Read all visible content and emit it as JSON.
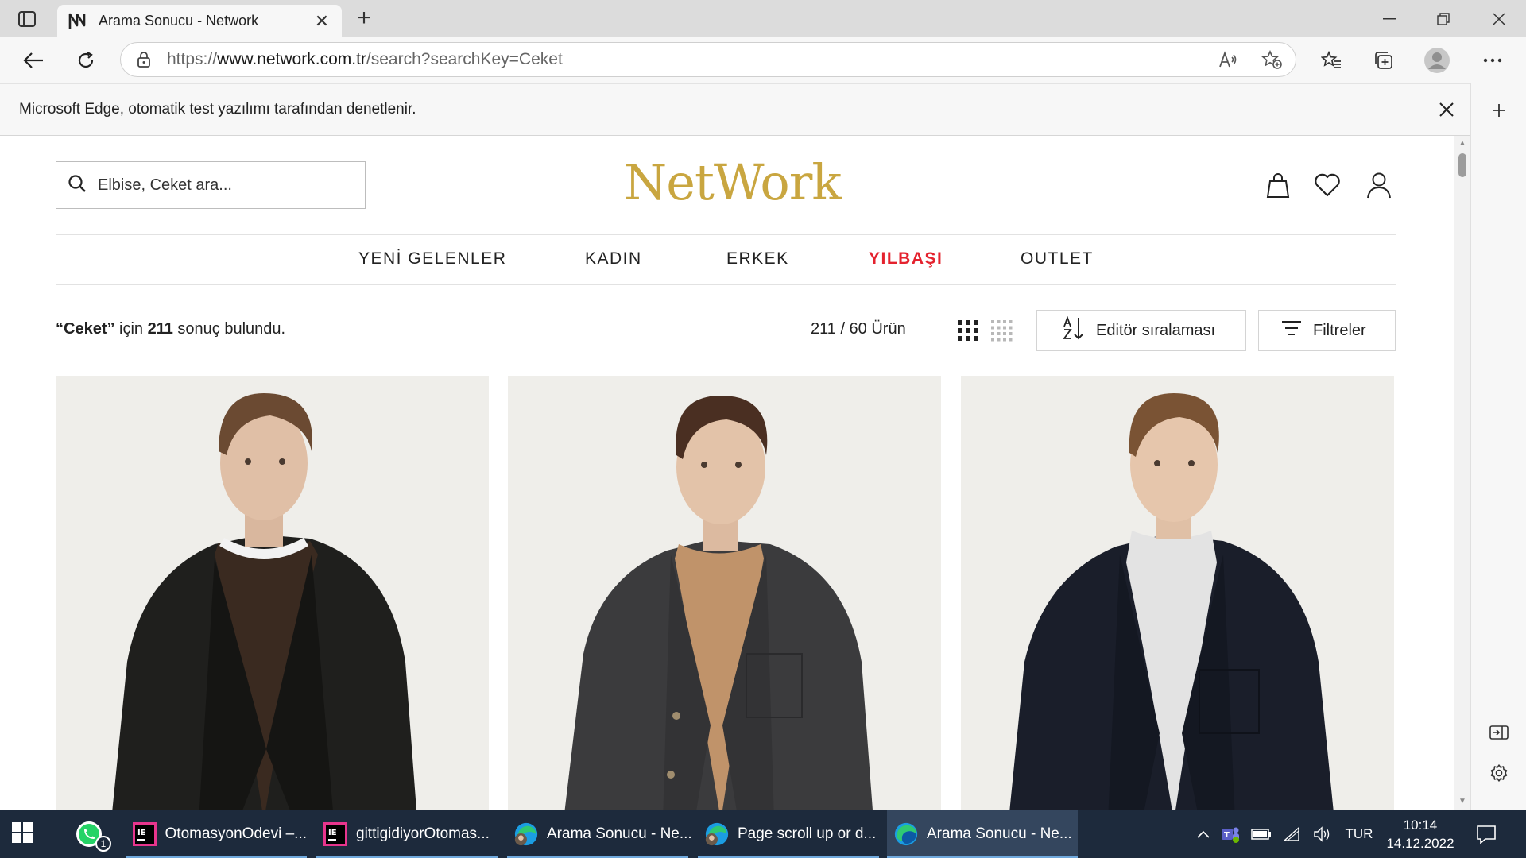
{
  "browser": {
    "tab_title": "Arama Sonucu - Network",
    "new_tab_label": "+",
    "url_scheme": "https://",
    "url_host": "www.network.com.tr",
    "url_path": "/search?searchKey=Ceket",
    "infobar_text": "Microsoft Edge, otomatik test yazılımı tarafından denetlenir."
  },
  "page": {
    "logo": "NetWork",
    "search_placeholder": "Elbise, Ceket ara...",
    "nav": [
      {
        "label": "YENİ GELENLER"
      },
      {
        "label": "KADIN"
      },
      {
        "label": "ERKEK"
      },
      {
        "label": "YILBAŞI",
        "highlight": true
      },
      {
        "label": "OUTLET"
      }
    ],
    "results": {
      "quote_open": "“",
      "query": "Ceket",
      "quote_close": "”",
      "for_word": " için ",
      "count": "211",
      "suffix": " sonuç bulundu."
    },
    "product_count": "211 / 60 Ürün",
    "sort_label": "Editör sıralaması",
    "filter_label": "Filtreler",
    "products": [
      {
        "name": "product-black-blazer",
        "jacket_color": "#1f1f1d",
        "sweater_color": "#3a2a20",
        "collar_color": "#f2f2f2"
      },
      {
        "name": "product-grey-overshirt",
        "jacket_color": "#3b3b3d",
        "sweater_color": "#c0936a",
        "collar_color": "#c0936a"
      },
      {
        "name": "product-navy-overshirt",
        "jacket_color": "#1a1e2a",
        "sweater_color": "#e3e3e3",
        "collar_color": "#e3e3e3"
      }
    ]
  },
  "taskbar": {
    "apps": [
      {
        "label": "OtomasyonOdevi –...",
        "icon": "intellij-icon"
      },
      {
        "label": "gittigidiyorOtomas...",
        "icon": "intellij-icon"
      },
      {
        "label": "Arama Sonucu - Ne...",
        "icon": "edge-profile-icon"
      },
      {
        "label": "Page scroll up or d...",
        "icon": "edge-profile-icon"
      },
      {
        "label": "Arama Sonucu - Ne...",
        "icon": "edge-icon"
      }
    ],
    "whatsapp_badge": "1",
    "language": "TUR",
    "time": "10:14",
    "date": "14.12.2022"
  },
  "colors": {
    "logo_gold": "#c9a640",
    "nav_highlight": "#e4222e",
    "taskbar_bg": "#1d2a3c"
  }
}
